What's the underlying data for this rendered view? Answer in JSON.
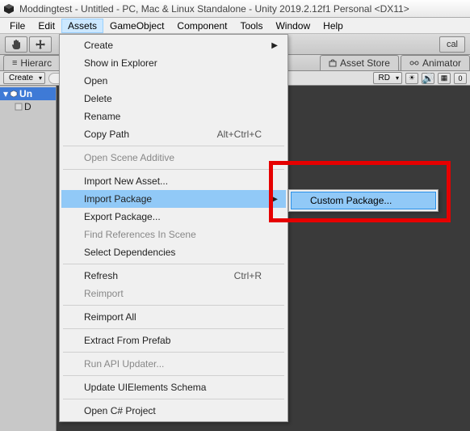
{
  "title": "Moddingtest - Untitled - PC, Mac & Linux Standalone - Unity 2019.2.12f1 Personal <DX11>",
  "menubar": [
    "File",
    "Edit",
    "Assets",
    "GameObject",
    "Component",
    "Tools",
    "Window",
    "Help"
  ],
  "menubar_active_index": 2,
  "toolbar_right_btn": "cal",
  "tabs": {
    "left": "Hierarc",
    "right1": "Asset Store",
    "right2": "Animator"
  },
  "subbar": {
    "create": "Create",
    "rd": "RD"
  },
  "hierarchy": {
    "root": "Un",
    "child": "D"
  },
  "scene_icons": {
    "speaker": "🔊",
    "num": "0"
  },
  "assets_menu": [
    {
      "label": "Create",
      "type": "sub",
      "arrow": true
    },
    {
      "label": "Show in Explorer",
      "type": "item"
    },
    {
      "label": "Open",
      "type": "item"
    },
    {
      "label": "Delete",
      "type": "item"
    },
    {
      "label": "Rename",
      "type": "item"
    },
    {
      "label": "Copy Path",
      "type": "item",
      "shortcut": "Alt+Ctrl+C"
    },
    {
      "type": "sep"
    },
    {
      "label": "Open Scene Additive",
      "type": "disabled"
    },
    {
      "type": "sep"
    },
    {
      "label": "Import New Asset...",
      "type": "item"
    },
    {
      "label": "Import Package",
      "type": "hover",
      "arrow": true
    },
    {
      "label": "Export Package...",
      "type": "item"
    },
    {
      "label": "Find References In Scene",
      "type": "disabled"
    },
    {
      "label": "Select Dependencies",
      "type": "item"
    },
    {
      "type": "sep"
    },
    {
      "label": "Refresh",
      "type": "item",
      "shortcut": "Ctrl+R"
    },
    {
      "label": "Reimport",
      "type": "disabled"
    },
    {
      "type": "sep"
    },
    {
      "label": "Reimport All",
      "type": "item"
    },
    {
      "type": "sep"
    },
    {
      "label": "Extract From Prefab",
      "type": "item"
    },
    {
      "type": "sep"
    },
    {
      "label": "Run API Updater...",
      "type": "disabled"
    },
    {
      "type": "sep"
    },
    {
      "label": "Update UIElements Schema",
      "type": "item"
    },
    {
      "type": "sep"
    },
    {
      "label": "Open C# Project",
      "type": "item"
    }
  ],
  "submenu": {
    "item": "Custom Package..."
  }
}
